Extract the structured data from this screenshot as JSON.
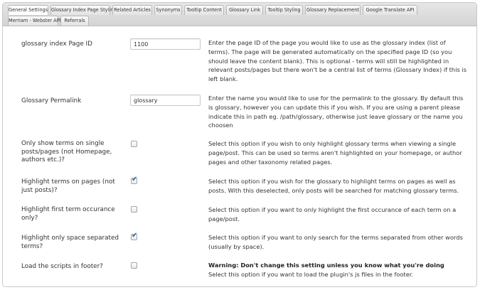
{
  "tabs": [
    {
      "label": "General Settings",
      "active": true
    },
    {
      "label": "Glossary Index Page Styling",
      "active": false
    },
    {
      "label": "Related Articles",
      "active": false
    },
    {
      "label": "Synonyms",
      "active": false
    },
    {
      "label": "Tooltip Content",
      "active": false
    },
    {
      "label": "Glossary Link",
      "active": false
    },
    {
      "label": "Tooltip Styling",
      "active": false
    },
    {
      "label": "Glossary Replacement",
      "active": false
    },
    {
      "label": "Google Translate API",
      "active": false
    },
    {
      "label": "Merriam - Webster API",
      "active": false
    },
    {
      "label": "Referrals",
      "active": false
    }
  ],
  "settings": {
    "index_page": {
      "label": "glossary index Page ID",
      "value": "1100",
      "description": "Enter the page ID of the page you would like to use as the glossary index (list of terms). The page will be generated automatically on the specified page ID (so you should leave the content blank). This is optional - terms will still be highlighted in relevant posts/pages but there won't be a central list of terms (Glossary Index) if this is left blank."
    },
    "permalink": {
      "label": "Glossary Permalink",
      "value": "glossary",
      "description": "Enter the name you would like to use for the permalink to the glossary. By default this is glossary, however you can update this if you wish. If you are using a parent please indicate this in path eg. /path/glossary, otherwise just leave glossary or the name you choosen"
    },
    "only_single": {
      "label": "Only show terms on single posts/pages (not Homepage, authors etc.)?",
      "checked": false,
      "description": "Select this option if you wish to only highlight glossary terms when viewing a single page/post. This can be used so terms aren't highlighted on your homepage, or author pages and other taxonomy related pages."
    },
    "highlight_pages": {
      "label": "Highlight terms on pages (not just posts)?",
      "checked": true,
      "description": "Select this option if you wish for the glossary to highlight terms on pages as well as posts. With this deselected, only posts will be searched for matching glossary terms."
    },
    "first_occurance": {
      "label": "Highlight first term occurance only?",
      "checked": false,
      "description": "Select this option if you want to only highlight the first occurance of each term on a page/post."
    },
    "space_separated": {
      "label": "Highlight only space separated terms?",
      "checked": true,
      "description": "Select this option if you want to only search for the terms separated from other words (usually by space)."
    },
    "scripts_footer": {
      "label": "Load the scripts in footer?",
      "checked": false,
      "warning": "Warning: Don't change this setting unless you know what you're doing",
      "description": "Select this option if you want to load the plugin's js files in the footer."
    }
  },
  "check_glyph": "✔",
  "colors": {
    "check": "#2d5bb3",
    "border": "#c9c9c9",
    "tabbar": "#dcdcdc"
  }
}
